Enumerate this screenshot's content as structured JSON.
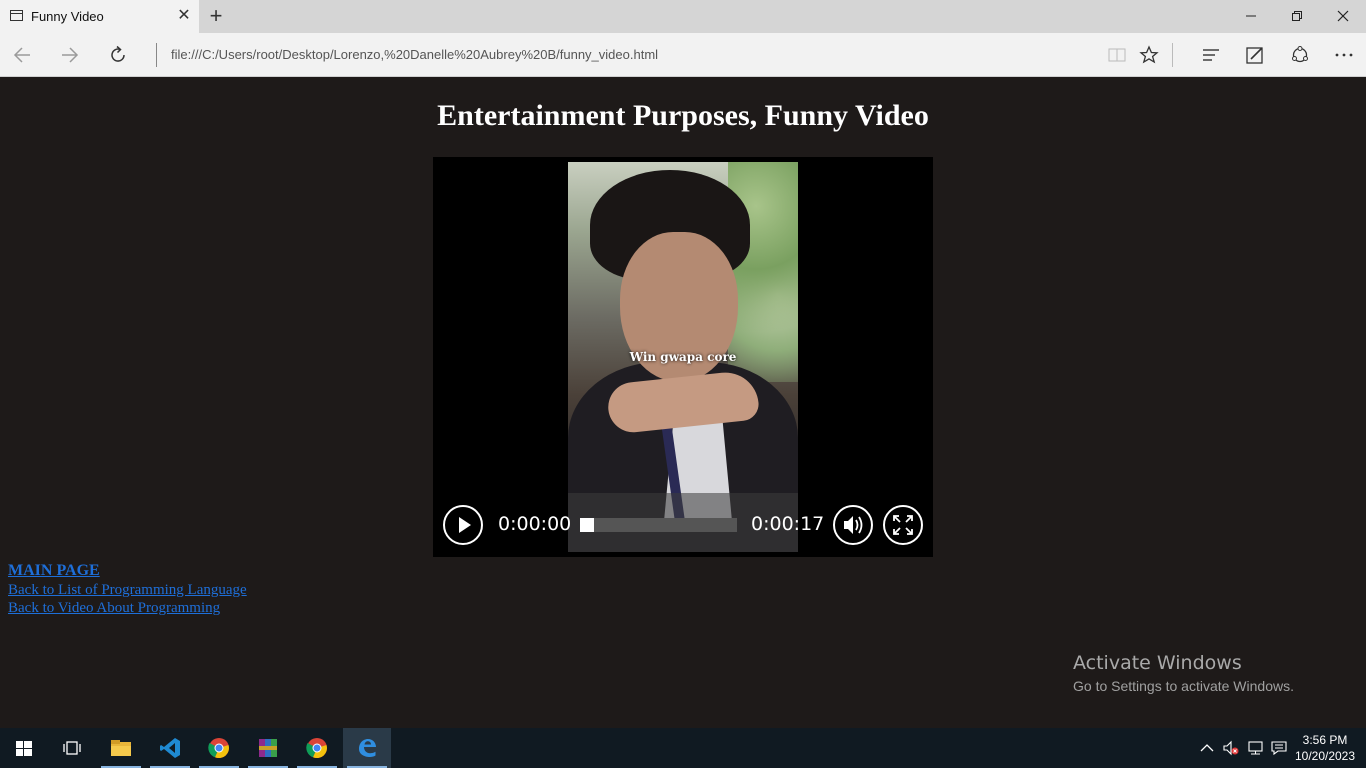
{
  "browser": {
    "tab_title": "Funny Video",
    "address": "file:///C:/Users/root/Desktop/Lorenzo,%20Danelle%20Aubrey%20B/funny_video.html"
  },
  "page": {
    "title": "Entertainment Purposes, Funny Video",
    "video": {
      "caption": "Win gwapa core",
      "current_time": "0:00:00",
      "duration": "0:00:17",
      "progress": 0
    },
    "links": [
      "MAIN PAGE",
      "Back to List of Programming Language",
      "Back to Video About Programming"
    ]
  },
  "watermark": {
    "title": "Activate Windows",
    "subtitle": "Go to Settings to activate Windows."
  },
  "taskbar": {
    "apps": [
      "start-icon",
      "task-view-icon",
      "file-explorer-icon",
      "vscode-icon",
      "chrome-icon",
      "winrar-icon",
      "chrome-icon",
      "edge-icon"
    ],
    "active_app": "edge-icon",
    "time": "3:56 PM",
    "date": "10/20/2023"
  },
  "colors": {
    "page_bg": "#1e1a19",
    "link": "#1e6fd9",
    "taskbar": "#101a22"
  }
}
